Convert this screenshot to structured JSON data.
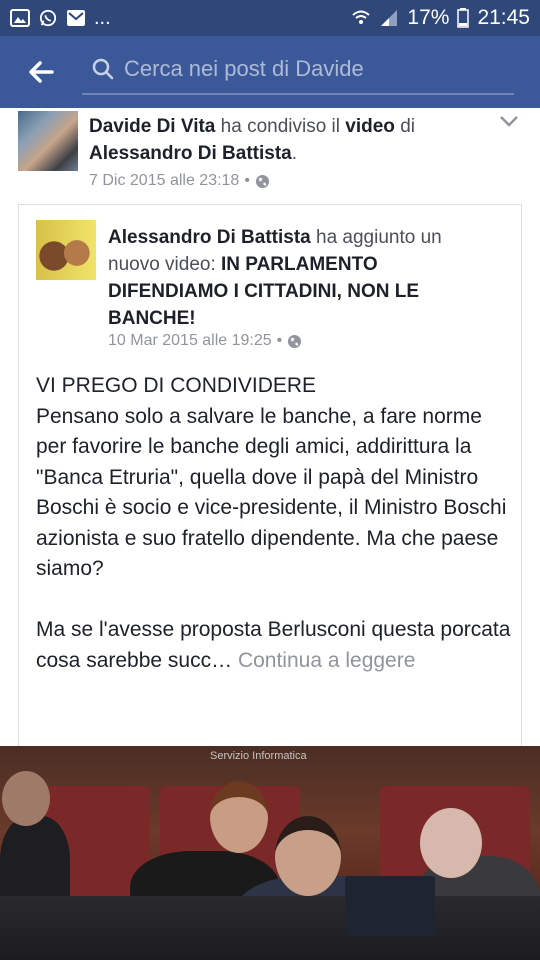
{
  "status_bar": {
    "battery": "17%",
    "time": "21:45",
    "notif_more": "..."
  },
  "nav": {
    "search_placeholder": "Cerca nei post di Davide"
  },
  "post": {
    "author": "Davide Di Vita",
    "action_pre": "ha condiviso il",
    "action_obj": "video",
    "action_post": "di",
    "shared_from": "Alessandro Di Battista",
    "dot": ".",
    "date": "7 Dic 2015 alle 23:18",
    "sep": "•"
  },
  "shared": {
    "author": "Alessandro Di Battista",
    "action": "ha aggiunto un nuovo video:",
    "video_title": "IN PARLAMENTO DIFENDIAMO I CITTADINI, NON LE BANCHE!",
    "date": "10 Mar 2015 alle 19:25",
    "sep": "•",
    "text": "VI PREGO DI CONDIVIDERE\nPensano solo a salvare le banche, a fare norme per favorire le banche degli amici, addirittura la \"Banca Etruria\", quella dove il papà del Ministro Boschi è socio e vice-presidente, il Ministro Boschi azionista e suo fratello dipendente. Ma che paese siamo?\n\nMa se l'avesse proposta Berlusconi questa porcata cosa sarebbe succ… ",
    "continue": "Continua a leggere"
  },
  "video": {
    "overlay_label": "Servizio Informatica"
  },
  "colors": {
    "status_bg": "#2f4779",
    "nav_bg": "#3b5998",
    "meta": "#90949c"
  }
}
